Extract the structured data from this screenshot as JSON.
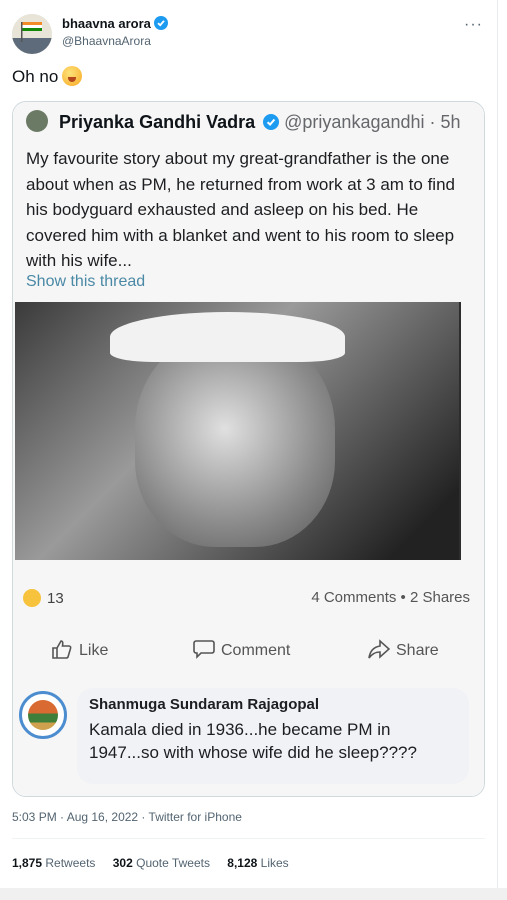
{
  "tweet": {
    "author_name": "bhaavna arora",
    "author_handle": "@BhaavnaArora",
    "more_label": "···",
    "text": "Oh no",
    "emoji": "hand-over-mouth-emoji",
    "timestamp": "5:03 PM · Aug 16, 2022 · Twitter for iPhone",
    "stats": {
      "retweets_count": "1,875",
      "retweets_label": "Retweets",
      "quotes_count": "302",
      "quotes_label": "Quote Tweets",
      "likes_count": "8,128",
      "likes_label": "Likes"
    }
  },
  "quoted_screenshot": {
    "name": "Priyanka Gandhi Vadra",
    "handle_time": "@priyankagandhi · 5h",
    "body": "My favourite story about my great-grandfather is the one about when as PM, he returned from work at 3 am to find his bodyguard exhausted and asleep on his bed. He covered him with a blanket and went to his room to sleep with his wife...",
    "show_thread": "Show this thread",
    "reaction_count": "13",
    "comments_shares": "4 Comments • 2 Shares",
    "like_label": "Like",
    "comment_label": "Comment",
    "share_label": "Share",
    "commenter": "Shanmuga Sundaram Rajagopal",
    "comment_text": "Kamala died in 1936...he became PM in 1947...so with whose wife did he sleep????"
  },
  "colors": {
    "verified": "#1d9bf0",
    "link": "#4a89a5",
    "border": "#cfd9de"
  }
}
